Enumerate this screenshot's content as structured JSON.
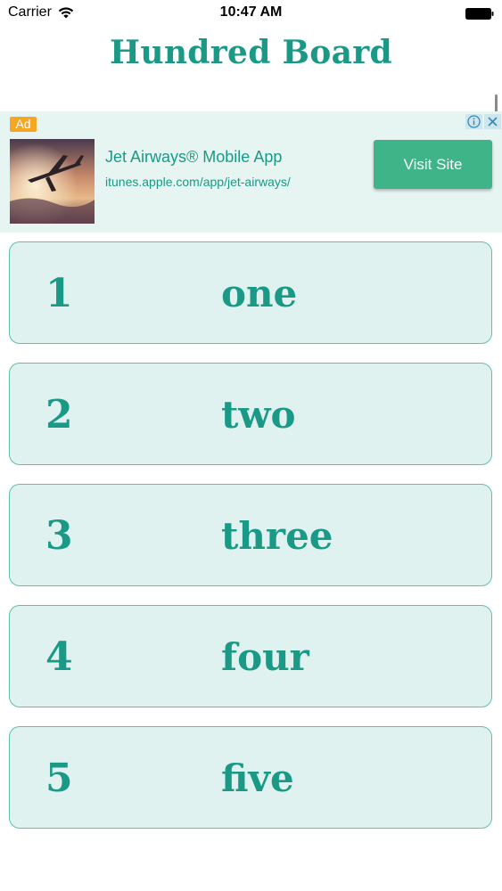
{
  "status_bar": {
    "carrier": "Carrier",
    "time": "10:47 AM",
    "wifi_icon": "wifi-icon",
    "battery_icon": "battery-icon"
  },
  "header": {
    "title": "Hundred Board"
  },
  "ad": {
    "badge": "Ad",
    "headline": "Jet Airways® Mobile App",
    "url": "itunes.apple.com/app/jet-airways/",
    "cta": "Visit Site",
    "info_icon": "info-icon",
    "close_icon": "close-icon",
    "image": "airplane-sunset-image"
  },
  "rows": [
    {
      "number": "1",
      "word": "one"
    },
    {
      "number": "2",
      "word": "two"
    },
    {
      "number": "3",
      "word": "three"
    },
    {
      "number": "4",
      "word": "four"
    },
    {
      "number": "5",
      "word": "five"
    }
  ],
  "colors": {
    "accent": "#1a9a86",
    "row_bg": "#e0f2ef",
    "row_border": "#5fbfae",
    "ad_bg": "#e6f4f2",
    "ad_cta": "#3fb488",
    "ad_badge": "#f5a623"
  }
}
